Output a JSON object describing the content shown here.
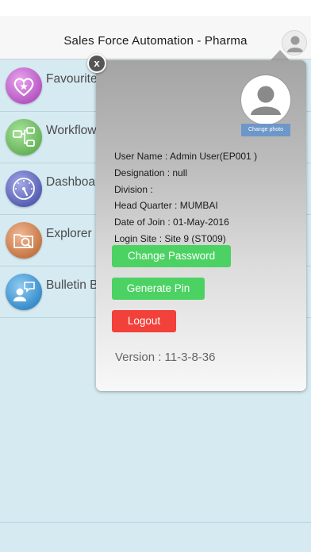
{
  "nav": {
    "title": "Sales Force Automation - Pharma",
    "profile_icon": "user-icon"
  },
  "menu": {
    "items": [
      {
        "label": "Favourite",
        "icon": "heart-star-icon",
        "color": "#c46fcc"
      },
      {
        "label": "Workflow",
        "icon": "workflow-icon",
        "color": "#78c46a"
      },
      {
        "label": "Dashboard",
        "icon": "gauge-icon",
        "color": "#6b73c4"
      },
      {
        "label": "Explorer",
        "icon": "folder-search-icon",
        "color": "#d98a55"
      },
      {
        "label": "Bulletin B",
        "icon": "bulletin-icon",
        "color": "#4a9fd8"
      }
    ]
  },
  "popup": {
    "close_label": "x",
    "change_photo_label": "Change photo",
    "user_name": "User Name : Admin User(EP001 )",
    "designation": "Designation : null",
    "division": "Division :",
    "head_quarter": "Head Quarter : MUMBAI",
    "date_of_join": "Date of Join : 01-May-2016",
    "login_site": "Login Site : Site 9 (ST009)",
    "change_password_label": "Change Password",
    "generate_pin_label": "Generate Pin",
    "logout_label": "Logout",
    "version": "Version : 11-3-8-36"
  },
  "colors": {
    "background": "#d6eaf1",
    "green_button": "#4cd263",
    "red_button": "#f2403a",
    "change_photo": "#6e97c9"
  }
}
